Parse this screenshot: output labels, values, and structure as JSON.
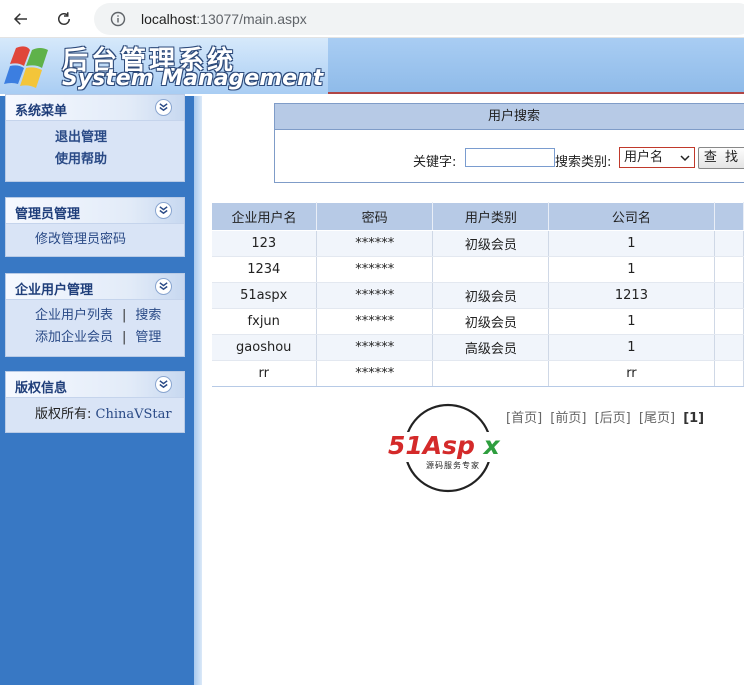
{
  "browser": {
    "url_host": "localhost",
    "url_rest": ":13077/main.aspx"
  },
  "header": {
    "title_cn": "后台管理系统",
    "title_en": "System Management"
  },
  "sidebar": {
    "panels": [
      {
        "title": "系统菜单",
        "links": [
          "退出管理",
          "使用帮助"
        ]
      },
      {
        "title": "管理员管理",
        "links": [
          "修改管理员密码"
        ]
      },
      {
        "title": "企业用户管理",
        "rows": [
          [
            "企业用户列表",
            "搜索"
          ],
          [
            "添加企业会员",
            "管理"
          ]
        ],
        "sep": "|"
      },
      {
        "title": "版权信息",
        "copyright_label": "版权所有:",
        "copyright_owner": "ChinaVStar"
      }
    ]
  },
  "search": {
    "title": "用户搜索",
    "keyword_label": "关键字:",
    "keyword_value": "",
    "category_label": "搜索类别:",
    "category_selected": "用户名",
    "find_button": "查 找"
  },
  "table": {
    "headers": [
      "企业用户名",
      "密码",
      "用户类别",
      "公司名",
      ""
    ],
    "rows": [
      [
        "123",
        "******",
        "初级会员",
        "1",
        ""
      ],
      [
        "1234",
        "******",
        "",
        "1",
        ""
      ],
      [
        "51aspx",
        "******",
        "初级会员",
        "1213",
        ""
      ],
      [
        "fxjun",
        "******",
        "初级会员",
        "1",
        ""
      ],
      [
        "gaoshou",
        "******",
        "高级会员",
        "1",
        ""
      ],
      [
        "rr",
        "******",
        "",
        "rr",
        ""
      ]
    ]
  },
  "pager": {
    "first": "[首页]",
    "prev": "[前页]",
    "next": "[后页]",
    "last": "[尾页]",
    "current": "[1]"
  },
  "brand": {
    "main": "51Aspx",
    "tagline": "源码服务专家"
  },
  "colors": {
    "sidebar_bg": "#3878c4",
    "header_bg": "#a9cdf3",
    "table_head": "#b7cae6",
    "brand_red": "#d42a2a",
    "brand_green": "#2e9e3e"
  }
}
